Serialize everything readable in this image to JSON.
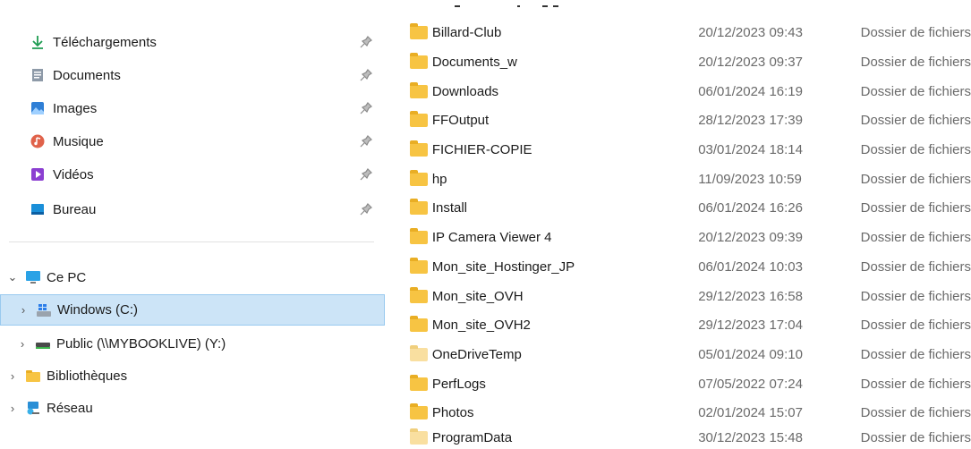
{
  "sidebar": {
    "quick_access": [
      {
        "label": "Téléchargements",
        "icon": "download-arrow-icon"
      },
      {
        "label": "Documents",
        "icon": "documents-icon"
      },
      {
        "label": "Images",
        "icon": "images-icon"
      },
      {
        "label": "Musique",
        "icon": "music-icon"
      },
      {
        "label": "Vidéos",
        "icon": "videos-icon"
      },
      {
        "label": "Bureau",
        "icon": "desktop-icon"
      }
    ],
    "tree": [
      {
        "label": "Ce PC",
        "chevron": "⌄",
        "icon": "pc-icon"
      },
      {
        "label": "Windows (C:)",
        "chevron": "›",
        "icon": "windows-drive-icon"
      },
      {
        "label": "Public (\\\\MYBOOKLIVE) (Y:)",
        "chevron": "›",
        "icon": "network-drive-icon"
      },
      {
        "label": "Bibliothèques",
        "chevron": "›",
        "icon": "libraries-folder-icon"
      },
      {
        "label": "Réseau",
        "chevron": "›",
        "icon": "network-icon"
      }
    ]
  },
  "files": [
    {
      "name": "Billard-Club",
      "date": "20/12/2023 09:43",
      "type": "Dossier de fichiers"
    },
    {
      "name": "Documents_w",
      "date": "20/12/2023 09:37",
      "type": "Dossier de fichiers"
    },
    {
      "name": "Downloads",
      "date": "06/01/2024 16:19",
      "type": "Dossier de fichiers"
    },
    {
      "name": "FFOutput",
      "date": "28/12/2023 17:39",
      "type": "Dossier de fichiers"
    },
    {
      "name": "FICHIER-COPIE",
      "date": "03/01/2024 18:14",
      "type": "Dossier de fichiers"
    },
    {
      "name": "hp",
      "date": "11/09/2023 10:59",
      "type": "Dossier de fichiers"
    },
    {
      "name": "Install",
      "date": "06/01/2024 16:26",
      "type": "Dossier de fichiers"
    },
    {
      "name": "IP Camera Viewer 4",
      "date": "20/12/2023 09:39",
      "type": "Dossier de fichiers"
    },
    {
      "name": "Mon_site_Hostinger_JP",
      "date": "06/01/2024 10:03",
      "type": "Dossier de fichiers"
    },
    {
      "name": "Mon_site_OVH",
      "date": "29/12/2023 16:58",
      "type": "Dossier de fichiers"
    },
    {
      "name": "Mon_site_OVH2",
      "date": "29/12/2023 17:04",
      "type": "Dossier de fichiers"
    },
    {
      "name": "OneDriveTemp",
      "date": "05/01/2024 09:10",
      "type": "Dossier de fichiers"
    },
    {
      "name": "PerfLogs",
      "date": "07/05/2022 07:24",
      "type": "Dossier de fichiers"
    },
    {
      "name": "Photos",
      "date": "02/01/2024 15:07",
      "type": "Dossier de fichiers"
    },
    {
      "name": "ProgramData",
      "date": "30/12/2023 15:48",
      "type": "Dossier de fichiers"
    }
  ],
  "colors": {
    "selection": "#cce4f7",
    "folder": "#f7c443",
    "secondary_text": "#6a6a6a"
  }
}
